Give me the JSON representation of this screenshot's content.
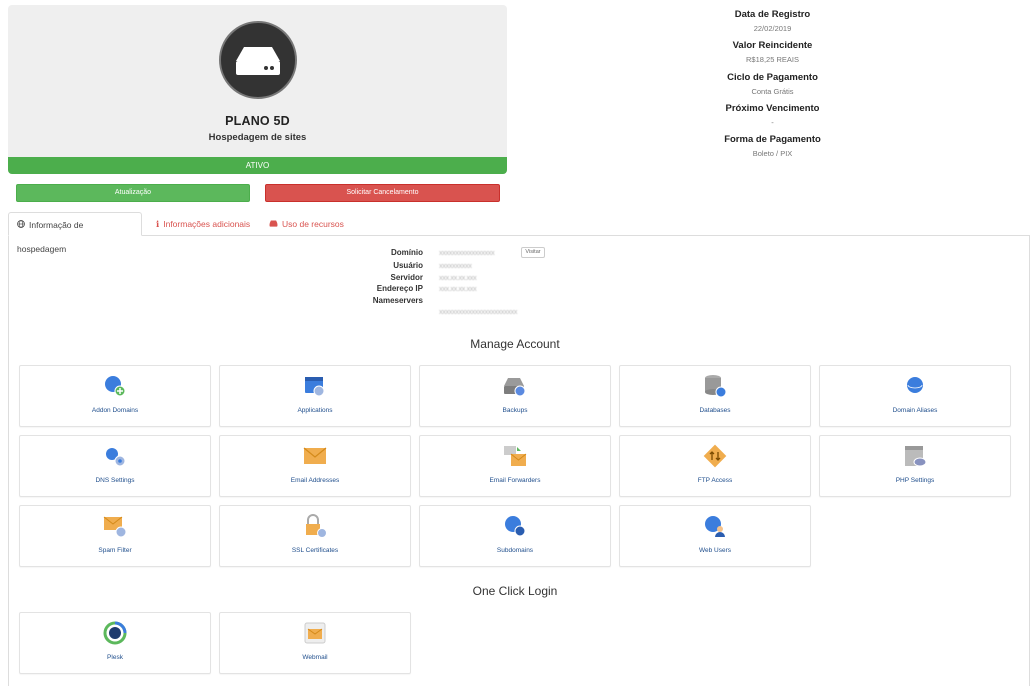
{
  "product": {
    "plan_name": "PLANO 5D",
    "plan_subtitle": "Hospedagem de sites",
    "status": "ATIVO",
    "icon": "server-icon"
  },
  "actions": {
    "update_label": "Atualização",
    "cancel_label": "Solicitar Cancelamento"
  },
  "info": [
    {
      "label": "Data de Registro",
      "value": "22/02/2019"
    },
    {
      "label": "Valor Reincidente",
      "value": "R$18,25 REAIS"
    },
    {
      "label": "Ciclo de Pagamento",
      "value": "Conta Grátis"
    },
    {
      "label": "Próximo Vencimento",
      "value": "-"
    },
    {
      "label": "Forma de Pagamento",
      "value": "Boleto / PIX"
    }
  ],
  "tabs": [
    {
      "label": "Informação de hospedagem",
      "icon": "globe-icon"
    },
    {
      "label": "Informações adicionais",
      "icon": "info-icon"
    },
    {
      "label": "Uso de recursos",
      "icon": "hdd-icon"
    }
  ],
  "details": {
    "labels": [
      "Domínio",
      "Usuário",
      "Servidor",
      "Endereço IP",
      "Nameservers"
    ],
    "values": [
      "xxxxxxxxxxxxxxxxx",
      "xxxxxxxxxx",
      "xxx.xx.xx.xxx",
      "xxx.xx.xx.xxx",
      "xxxxxxxxxxxxxxxxxxxxxxxx"
    ],
    "visit_label": "Visitar"
  },
  "manage_account": {
    "title": "Manage Account",
    "items": [
      {
        "label": "Addon Domains",
        "icon": "addon-domains-icon"
      },
      {
        "label": "Applications",
        "icon": "applications-icon"
      },
      {
        "label": "Backups",
        "icon": "backups-icon"
      },
      {
        "label": "Databases",
        "icon": "databases-icon"
      },
      {
        "label": "Domain Aliases",
        "icon": "domain-aliases-icon"
      },
      {
        "label": "DNS Settings",
        "icon": "dns-settings-icon"
      },
      {
        "label": "Email Addresses",
        "icon": "email-addresses-icon"
      },
      {
        "label": "Email Forwarders",
        "icon": "email-forwarders-icon"
      },
      {
        "label": "FTP Access",
        "icon": "ftp-access-icon"
      },
      {
        "label": "PHP Settings",
        "icon": "php-settings-icon"
      },
      {
        "label": "Spam Filter",
        "icon": "spam-filter-icon"
      },
      {
        "label": "SSL Certificates",
        "icon": "ssl-certificates-icon"
      },
      {
        "label": "Subdomains",
        "icon": "subdomains-icon"
      },
      {
        "label": "Web Users",
        "icon": "web-users-icon"
      }
    ]
  },
  "one_click_login": {
    "title": "One Click Login",
    "items": [
      {
        "label": "Plesk",
        "icon": "plesk-icon"
      },
      {
        "label": "Webmail",
        "icon": "webmail-icon"
      }
    ]
  },
  "colors": {
    "active_green": "#4cae4c",
    "cancel_red": "#d9534f",
    "link_blue": "#1f4e8c"
  }
}
